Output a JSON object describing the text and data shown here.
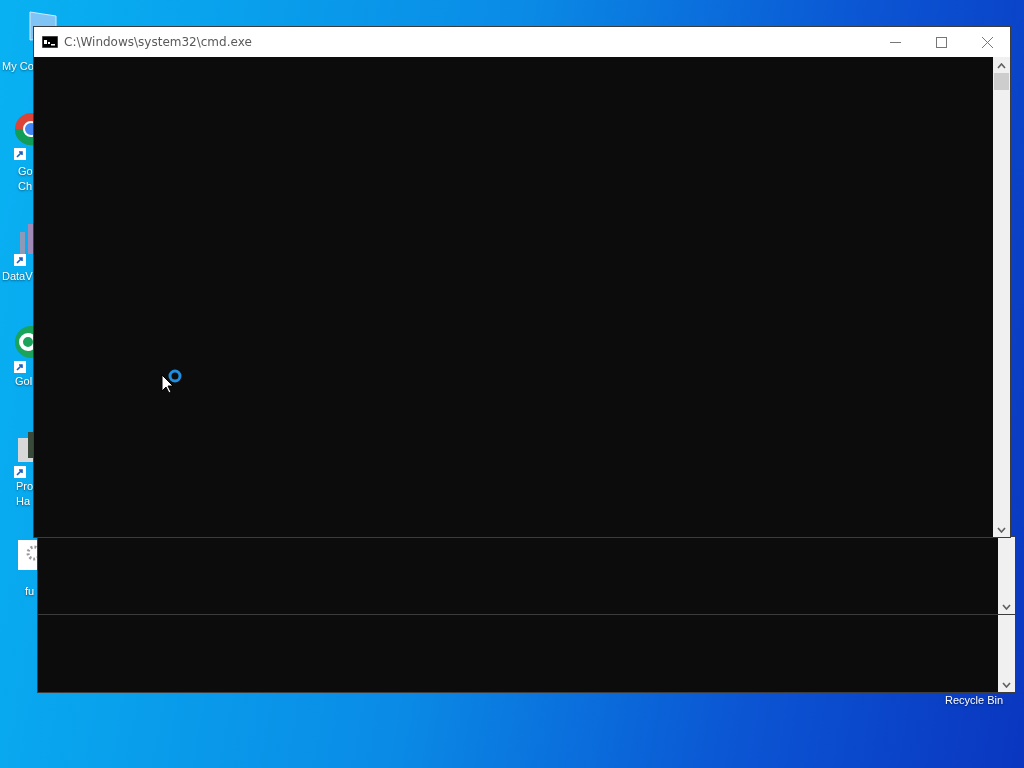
{
  "desktop_icons": [
    {
      "kind": "computer",
      "lines": [
        "My Co"
      ]
    },
    {
      "kind": "chrome",
      "lines": [
        "Go",
        "Ch"
      ]
    },
    {
      "kind": "chart",
      "lines": [
        "DataV"
      ]
    },
    {
      "kind": "green",
      "lines": [
        "Gol"
      ]
    },
    {
      "kind": "machine",
      "lines": [
        "Pro",
        "Ha"
      ]
    },
    {
      "kind": "settings",
      "lines": [
        "fu"
      ]
    },
    {
      "kind": "recycle",
      "lines": [
        "Recycle Bin"
      ]
    }
  ],
  "background_windows": [
    {
      "kind": "console"
    },
    {
      "kind": "console"
    }
  ],
  "window": {
    "title": "C:\\Windows\\system32\\cmd.exe",
    "active": true
  }
}
